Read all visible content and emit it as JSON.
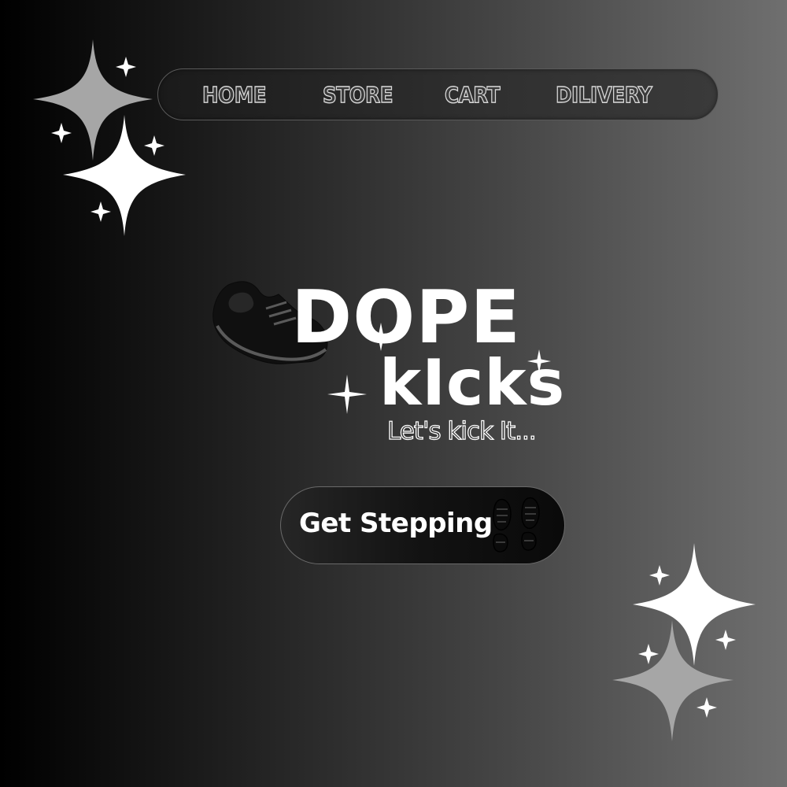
{
  "nav": {
    "items": [
      {
        "label": "HOME"
      },
      {
        "label": "STORE"
      },
      {
        "label": "CART"
      },
      {
        "label": "DILIVERY"
      }
    ]
  },
  "hero": {
    "title_line1": "DOPE",
    "title_line2": "kIcks",
    "tagline": "Let's kick It..."
  },
  "cta": {
    "label": "Get Stepping",
    "icon": "footprints-icon"
  },
  "icons": {
    "shoe": "sneaker-icon",
    "sparkle": "sparkle-icon"
  },
  "colors": {
    "background_left": "#000000",
    "background_right": "#6f6f6f",
    "text": "#ffffff",
    "sparkle_white": "#ffffff",
    "sparkle_gray": "#a6a6a6"
  }
}
